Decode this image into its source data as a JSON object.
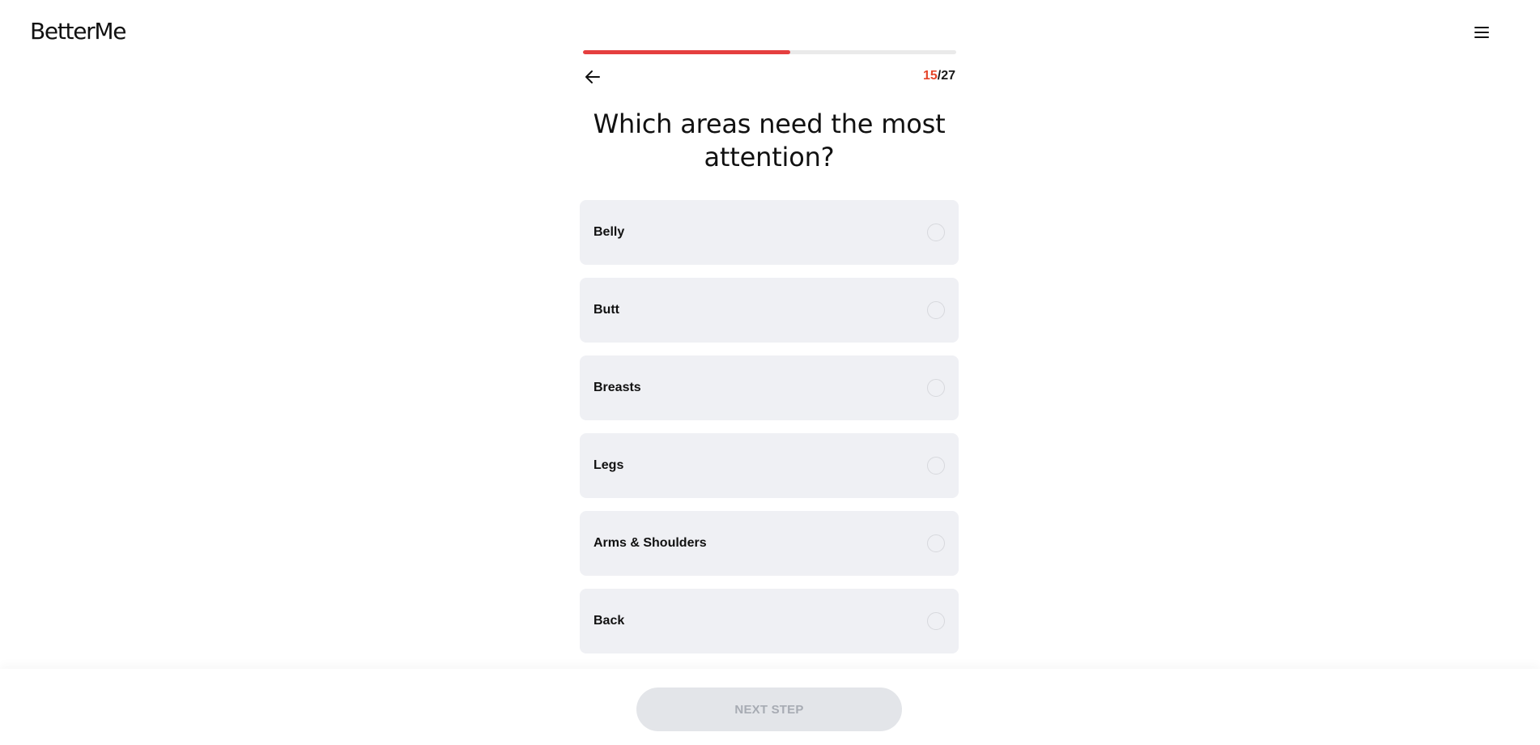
{
  "header": {
    "logo_text": "BetterMe",
    "menu_icon": "hamburger-menu-icon"
  },
  "progress": {
    "fraction": 0.555,
    "fill_color": "#e53f3f",
    "current_step": "15",
    "separator": "/",
    "total_steps": "27",
    "back_icon": "arrow-left-icon"
  },
  "question": {
    "text": "Which areas need the most attention?"
  },
  "options": [
    {
      "label": "Belly",
      "selected": false
    },
    {
      "label": "Butt",
      "selected": false
    },
    {
      "label": "Breasts",
      "selected": false
    },
    {
      "label": "Legs",
      "selected": false
    },
    {
      "label": "Arms & Shoulders",
      "selected": false
    },
    {
      "label": "Back",
      "selected": false
    }
  ],
  "footer": {
    "next_label": "NEXT STEP",
    "next_disabled": true
  },
  "colors": {
    "accent": "#e5452a",
    "option_bg": "#eff0f4",
    "button_disabled_bg": "#e3e5e9"
  }
}
